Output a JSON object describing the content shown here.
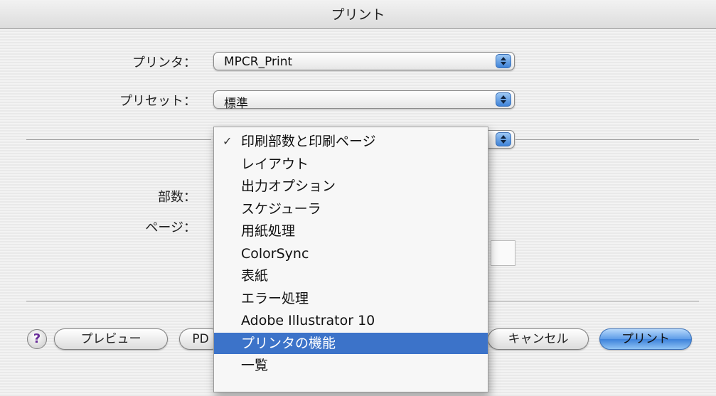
{
  "window": {
    "title": "プリント"
  },
  "form": {
    "printer_label": "プリンタ：",
    "printer_value": "MPCR_Print",
    "preset_label": "プリセット：",
    "preset_value": "標準",
    "copies_label": "部数：",
    "pages_label": "ページ："
  },
  "menu": {
    "items": [
      {
        "label": "印刷部数と印刷ページ",
        "checked": true,
        "selected": false
      },
      {
        "label": "レイアウト",
        "checked": false,
        "selected": false
      },
      {
        "label": "出力オプション",
        "checked": false,
        "selected": false
      },
      {
        "label": "スケジューラ",
        "checked": false,
        "selected": false
      },
      {
        "label": "用紙処理",
        "checked": false,
        "selected": false
      },
      {
        "label": "ColorSync",
        "checked": false,
        "selected": false
      },
      {
        "label": "表紙",
        "checked": false,
        "selected": false
      },
      {
        "label": "エラー処理",
        "checked": false,
        "selected": false
      },
      {
        "label": "Adobe Illustrator 10",
        "checked": false,
        "selected": false
      },
      {
        "label": "プリンタの機能",
        "checked": false,
        "selected": true
      },
      {
        "label": "一覧",
        "checked": false,
        "selected": false
      }
    ],
    "check_glyph": "✓"
  },
  "buttons": {
    "help": "?",
    "preview": "プレビュー",
    "pdf": "PD",
    "cancel": "キャンセル",
    "print": "プリント"
  },
  "colors": {
    "selection": "#3c73c9",
    "accent": "#3f83d8"
  }
}
